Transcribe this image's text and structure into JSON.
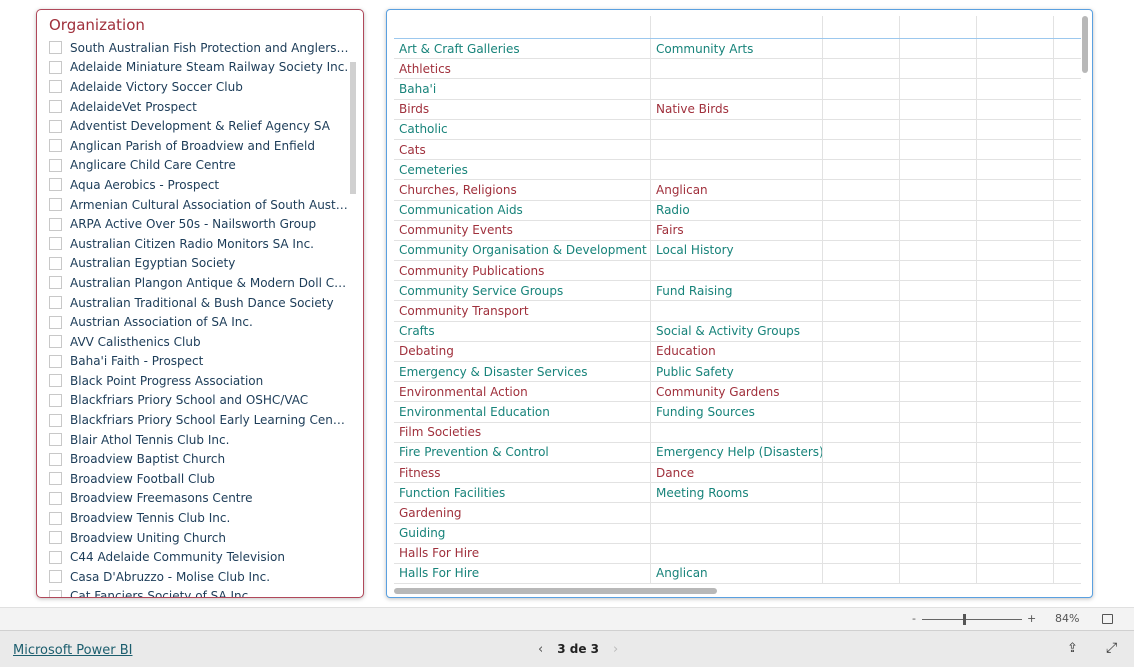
{
  "slicer": {
    "title": "Organization",
    "items": [
      "South Australian Fish Protection and Anglers A...",
      "Adelaide Miniature Steam Railway Society Inc.",
      "Adelaide Victory Soccer Club",
      "AdelaideVet Prospect",
      "Adventist Development & Relief Agency SA",
      "Anglican Parish of Broadview and Enfield",
      "Anglicare Child Care Centre",
      "Aqua Aerobics - Prospect",
      "Armenian Cultural Association of South Austra...",
      "ARPA Active Over 50s - Nailsworth Group",
      "Australian Citizen Radio Monitors SA Inc.",
      "Australian Egyptian Society",
      "Australian Plangon Antique & Modern Doll Co...",
      "Australian Traditional & Bush Dance Society",
      "Austrian Association of SA Inc.",
      "AVV Calisthenics Club",
      "Baha'i Faith - Prospect",
      "Black Point Progress Association",
      "Blackfriars Priory School and OSHC/VAC",
      "Blackfriars Priory School Early Learning Centre",
      "Blair Athol Tennis Club Inc.",
      "Broadview Baptist Church",
      "Broadview Football Club",
      "Broadview Freemasons Centre",
      "Broadview Tennis Club Inc.",
      "Broadview Uniting Church",
      "C44 Adelaide Community Television",
      "Casa D'Abruzzo - Molise Club Inc.",
      "Cat Fanciers Society of SA Inc."
    ]
  },
  "table": {
    "rows": [
      [
        "Art & Craft Galleries",
        "Community Arts"
      ],
      [
        "Athletics",
        ""
      ],
      [
        "Baha'i",
        ""
      ],
      [
        "Birds",
        "Native Birds"
      ],
      [
        "Catholic",
        ""
      ],
      [
        "Cats",
        ""
      ],
      [
        "Cemeteries",
        ""
      ],
      [
        "Churches, Religions",
        "Anglican"
      ],
      [
        "Communication Aids",
        "Radio"
      ],
      [
        "Community Events",
        "Fairs"
      ],
      [
        "Community Organisation & Development",
        "Local History"
      ],
      [
        "Community Publications",
        ""
      ],
      [
        "Community Service Groups",
        "Fund Raising"
      ],
      [
        "Community Transport",
        ""
      ],
      [
        "Crafts",
        "Social & Activity Groups"
      ],
      [
        "Debating",
        "Education"
      ],
      [
        "Emergency & Disaster Services",
        "Public Safety"
      ],
      [
        "Environmental Action",
        "Community Gardens"
      ],
      [
        "Environmental Education",
        "Funding Sources"
      ],
      [
        "Film Societies",
        ""
      ],
      [
        "Fire Prevention & Control",
        "Emergency Help (Disasters)"
      ],
      [
        "Fitness",
        "Dance"
      ],
      [
        "Function Facilities",
        "Meeting Rooms"
      ],
      [
        "Gardening",
        ""
      ],
      [
        "Guiding",
        ""
      ],
      [
        "Halls For Hire",
        ""
      ],
      [
        "Halls For Hire",
        "Anglican"
      ]
    ],
    "colors": {
      "even": "#17837a",
      "odd": "#a0303c"
    }
  },
  "zoom": {
    "minus": "-",
    "plus": "+",
    "level": "84%",
    "level_value": 84
  },
  "footer": {
    "brand": "Microsoft Power BI",
    "page": "3 de 3",
    "prev": "‹",
    "next": "›"
  }
}
